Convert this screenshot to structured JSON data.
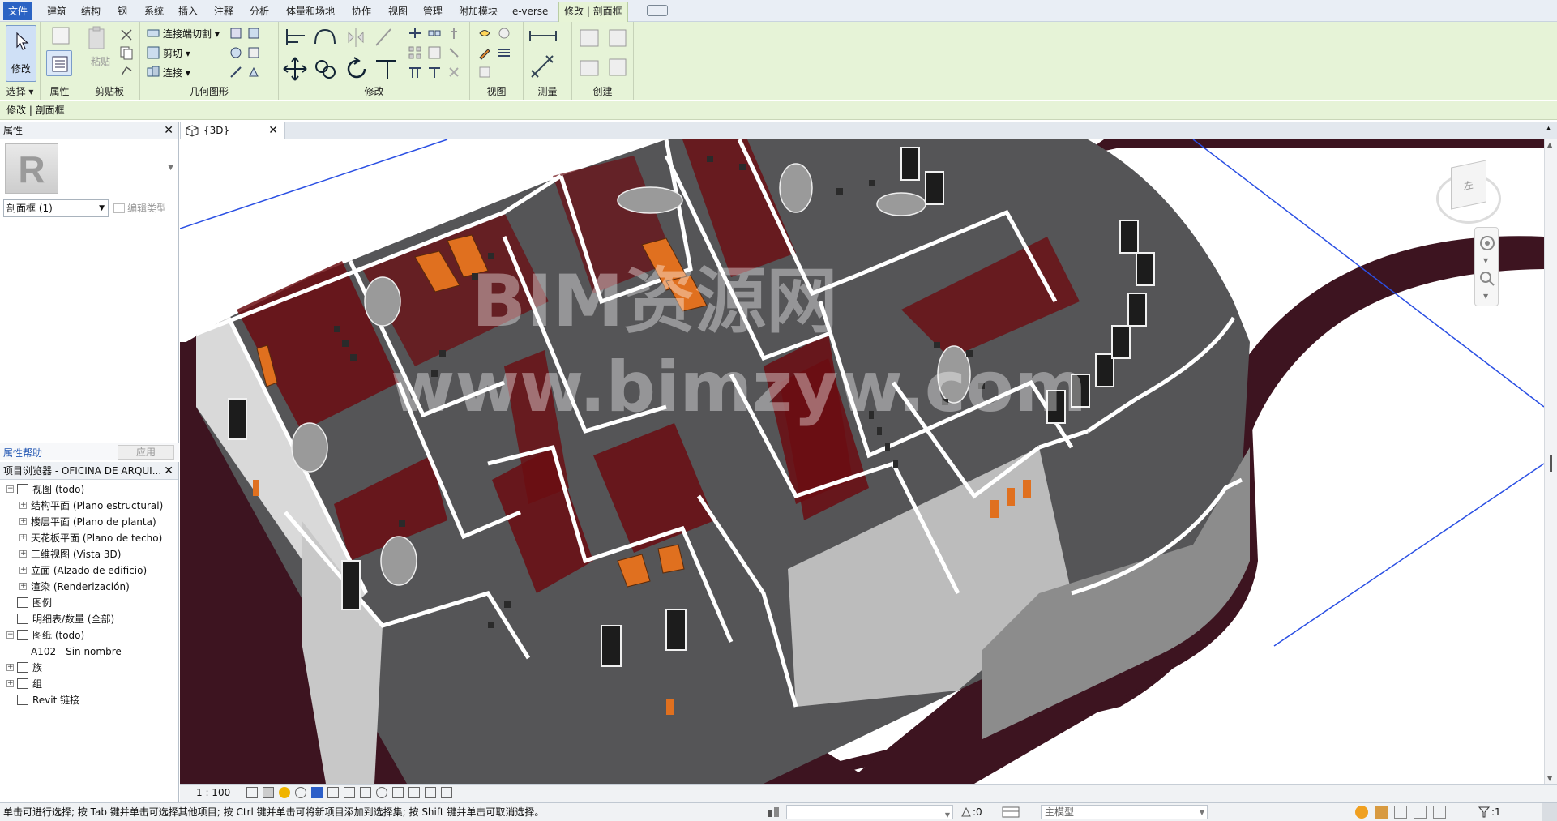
{
  "ribbon": {
    "tabs": [
      "文件",
      "建筑",
      "结构",
      "钢",
      "系统",
      "插入",
      "注释",
      "分析",
      "体量和场地",
      "协作",
      "视图",
      "管理",
      "附加模块",
      "e-verse",
      "修改 | 剖面框"
    ],
    "active_tab": "修改 | 剖面框",
    "panels": {
      "select": {
        "label": "选择 ▾",
        "modify_label": "修改"
      },
      "properties": {
        "label": "属性"
      },
      "clipboard": {
        "label": "剪贴板",
        "paste_label": "粘贴"
      },
      "geometry": {
        "label": "几何图形",
        "items": [
          "连接端切割 ▾",
          "剪切 ▾",
          "连接 ▾"
        ]
      },
      "modify": {
        "label": "修改"
      },
      "view": {
        "label": "视图"
      },
      "measure": {
        "label": "测量"
      },
      "create": {
        "label": "创建"
      }
    }
  },
  "context_bar": {
    "text": "修改 | 剖面框"
  },
  "properties_panel": {
    "title": "属性",
    "logo_letter": "R",
    "type_selector": "剖面框 (1)",
    "edit_type": "编辑类型",
    "help_link": "属性帮助",
    "apply_button": "应用"
  },
  "project_browser": {
    "title": "项目浏览器 - OFICINA DE ARQUI...",
    "items": [
      {
        "label": "视图 (todo)",
        "level": 0
      },
      {
        "label": "结构平面 (Plano estructural)",
        "level": 1
      },
      {
        "label": "楼层平面 (Plano de planta)",
        "level": 1
      },
      {
        "label": "天花板平面 (Plano de techo)",
        "level": 1
      },
      {
        "label": "三维视图 (Vista 3D)",
        "level": 1
      },
      {
        "label": "立面 (Alzado de edificio)",
        "level": 1
      },
      {
        "label": "渲染 (Renderización)",
        "level": 1
      },
      {
        "label": "图例",
        "level": 0
      },
      {
        "label": "明细表/数量 (全部)",
        "level": 0
      },
      {
        "label": "图纸 (todo)",
        "level": 0
      },
      {
        "label": "A102 - Sin nombre",
        "level": 1
      },
      {
        "label": "族",
        "level": 0
      },
      {
        "label": "组",
        "level": 0
      },
      {
        "label": "Revit 链接",
        "level": 0
      }
    ]
  },
  "view": {
    "tab_label": "{3D}",
    "watermark_line1": "BIM资源网",
    "watermark_line2": "www.bimzyw.com",
    "viewcube_label": "左"
  },
  "view_control": {
    "scale": "1 : 100"
  },
  "status_bar": {
    "message": "单击可进行选择; 按 Tab 键并单击可选择其他项目; 按 Ctrl 键并单击可将新项目添加到选择集; 按 Shift 键并单击可取消选择。",
    "selection_count": ":0",
    "model_selector": "主模型",
    "filter_count": ":1"
  },
  "colors": {
    "ribbon_green": "#e6f3d7",
    "file_tab_blue": "#2b63c4",
    "wall_maroon": "#6b0d12",
    "floor_gray": "#595959",
    "furniture_orange": "#e0701f",
    "site_maroon": "#3d1420"
  }
}
